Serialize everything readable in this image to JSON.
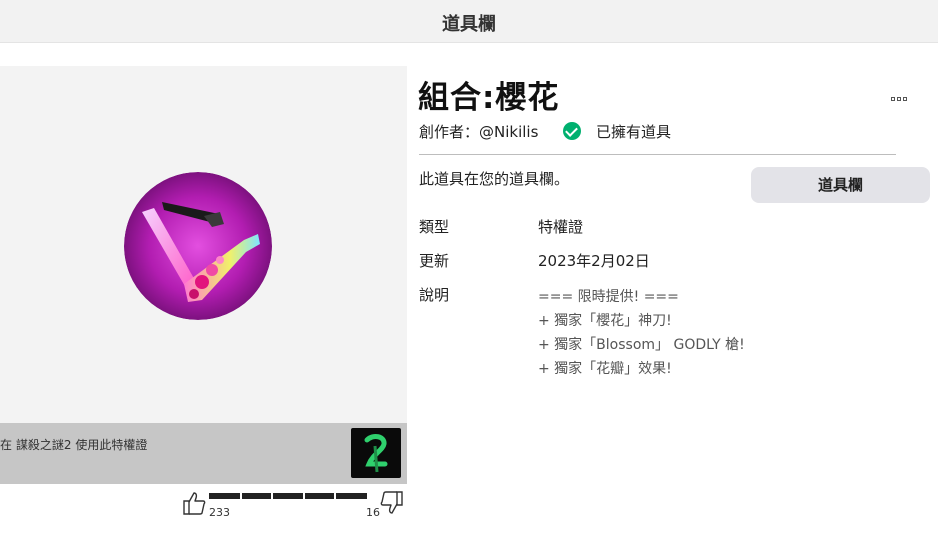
{
  "header": {
    "title": "道具欄"
  },
  "item": {
    "title": "組合:櫻花",
    "creator": "創作者：@Nikilis",
    "owned_label": "已擁有道具",
    "inventory_text": "此道具在您的道具欄。",
    "inventory_button": "道具欄"
  },
  "details": {
    "type_label": "類型",
    "type_value": "特權證",
    "updated_label": "更新",
    "updated_value": "2023年2月02日",
    "description_label": "說明",
    "description_lines": [
      "=== 限時提供! ===",
      "+ 獨家「櫻花」神刀!",
      "+ 獨家「Blossom」 GODLY 槍!",
      "+ 獨家「花瓣」效果!"
    ]
  },
  "game": {
    "text_prefix": "在",
    "name": "謀殺之謎2",
    "text_suffix": "使用此特權證"
  },
  "votes": {
    "up": "233",
    "down": "16",
    "up_fraction": 0.94
  },
  "colors": {
    "owned_check": "#00b06f",
    "button_bg": "#e3e3e8",
    "thumb_bg": "#b31fb0"
  },
  "icons": {
    "more": "more-icon",
    "check": "check-icon",
    "thumbs_up": "thumbs-up-icon",
    "thumbs_down": "thumbs-down-icon"
  }
}
